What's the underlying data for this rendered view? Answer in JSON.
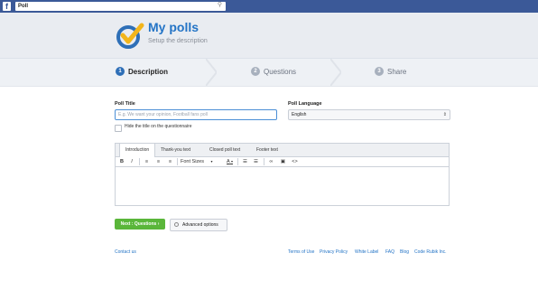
{
  "facebook": {
    "logo": "f",
    "search_value": "Poll",
    "search_icon": "magnifier-icon"
  },
  "header": {
    "title": "My polls",
    "subtitle": "Setup the description",
    "logo_icon": "check-badge-icon"
  },
  "steps": [
    {
      "number": "1",
      "label": "Description",
      "active": true
    },
    {
      "number": "2",
      "label": "Questions",
      "active": false
    },
    {
      "number": "3",
      "label": "Share",
      "active": false
    }
  ],
  "form": {
    "title_label": "Poll Title",
    "title_placeholder": "E.g. We want your opinion, Football fans poll",
    "language_label": "Poll Language",
    "language_value": "English",
    "hide_title_label": "Hide the title on the questionnaire"
  },
  "editor": {
    "tabs": [
      "Introduction",
      "Thank-you text",
      "Closed poll text",
      "Footer text"
    ],
    "toolbar": {
      "bold": "B",
      "italic": "I",
      "font_sizes": "Font Sizes",
      "font_color": "A"
    }
  },
  "buttons": {
    "next": "Next : Questions ›",
    "advanced": "Advanced options"
  },
  "footer": {
    "contact": "Contact us",
    "links": [
      "Terms of Use",
      "Privacy Policy",
      "White Label",
      "FAQ",
      "Blog",
      "Code Rubik Inc."
    ]
  },
  "colors": {
    "facebook": "#3b5998",
    "accent": "#2474c6",
    "next_button": "#5ab63a"
  }
}
